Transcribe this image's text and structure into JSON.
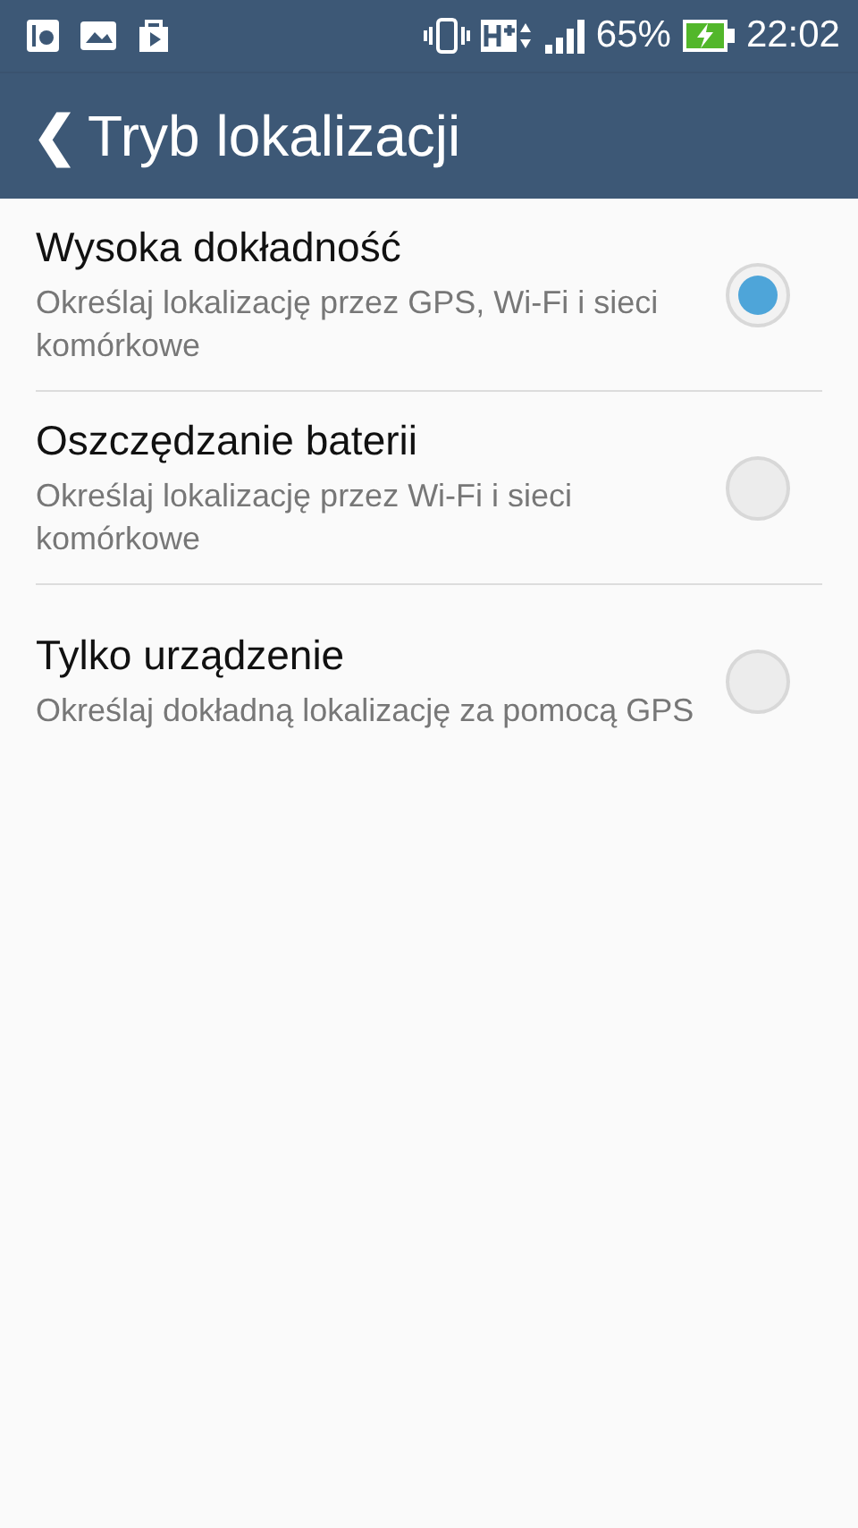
{
  "status_bar": {
    "battery_text": "65%",
    "time": "22:02"
  },
  "app_bar": {
    "back": "❮",
    "title": "Tryb lokalizacji"
  },
  "options": [
    {
      "title": "Wysoka dokładność",
      "summary": "Określaj lokalizację przez GPS, Wi-Fi i sieci komórkowe",
      "selected": true
    },
    {
      "title": "Oszczędzanie baterii",
      "summary": "Określaj lokalizację przez Wi-Fi i sieci komórkowe",
      "selected": false
    },
    {
      "title": "Tylko urządzenie",
      "summary": "Określaj dokładną lokalizację za pomocą GPS",
      "selected": false
    }
  ]
}
